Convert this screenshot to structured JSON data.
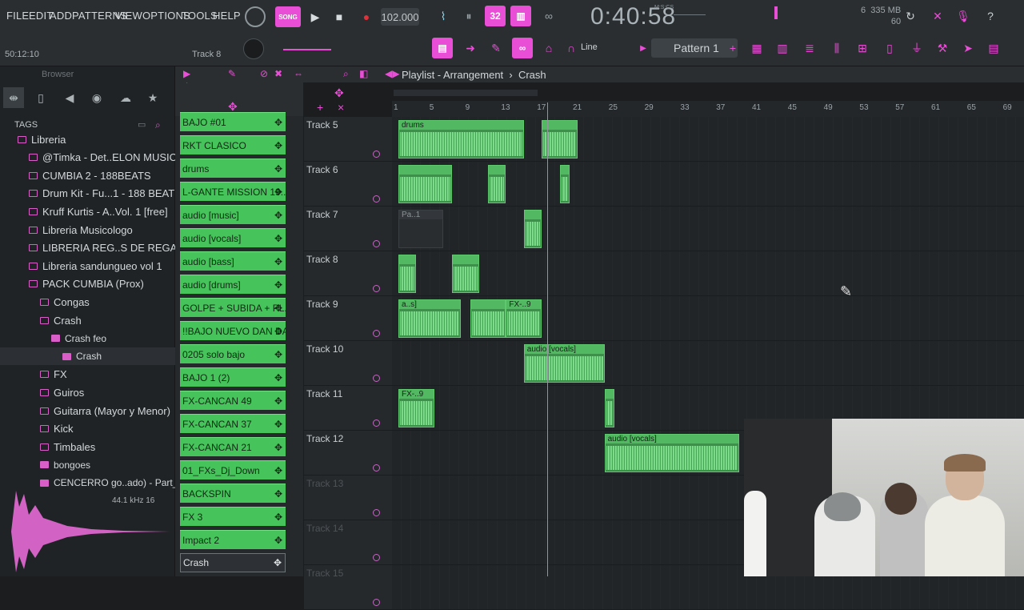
{
  "menu": [
    "FILE",
    "EDIT",
    "ADD",
    "PATTERNS",
    "VIEW",
    "OPTIONS",
    "TOOLS",
    "HELP"
  ],
  "transport": {
    "tempo": "102.000",
    "time": "0:40:58",
    "time_sub": "M:S:CS",
    "song_label": "SONG"
  },
  "status": {
    "mem": "335 MB",
    "cpu_count": "6",
    "poly": "60"
  },
  "hint": {
    "position": "50:12:10",
    "track": "Track 8"
  },
  "snap": {
    "value": "Line"
  },
  "pattern": {
    "name": "Pattern 1"
  },
  "browser": {
    "title": "Browser",
    "tags_label": "TAGS",
    "tree": [
      {
        "label": "Libreria",
        "indent": 1,
        "fill": false,
        "sel": false
      },
      {
        "label": "@Timka - Det..ELON MUSIC_",
        "indent": 2,
        "fill": false,
        "sel": false
      },
      {
        "label": "CUMBIA 2 - 188BEATS",
        "indent": 2,
        "fill": false,
        "sel": false
      },
      {
        "label": "Drum Kit - Fu...1 - 188 BEATS",
        "indent": 2,
        "fill": false,
        "sel": false
      },
      {
        "label": "Kruff Kurtis - A..Vol. 1 [free]",
        "indent": 2,
        "fill": false,
        "sel": false
      },
      {
        "label": "Libreria Musicologo",
        "indent": 2,
        "fill": false,
        "sel": false
      },
      {
        "label": "LIBRERIA REG..S DE REGALO",
        "indent": 2,
        "fill": false,
        "sel": false
      },
      {
        "label": "Libreria sandungueo vol 1",
        "indent": 2,
        "fill": false,
        "sel": false
      },
      {
        "label": "PACK CUMBIA (Prox)",
        "indent": 2,
        "fill": false,
        "sel": false
      },
      {
        "label": "Congas",
        "indent": 3,
        "fill": false,
        "sel": false
      },
      {
        "label": "Crash",
        "indent": 3,
        "fill": false,
        "sel": false
      },
      {
        "label": "Crash feo",
        "indent": 4,
        "fill": true,
        "sel": false
      },
      {
        "label": "Crash",
        "indent": 5,
        "fill": true,
        "sel": true
      },
      {
        "label": "FX",
        "indent": 3,
        "fill": false,
        "sel": false
      },
      {
        "label": "Guiros",
        "indent": 3,
        "fill": false,
        "sel": false
      },
      {
        "label": "Guitarra (Mayor y Menor)",
        "indent": 3,
        "fill": false,
        "sel": false
      },
      {
        "label": "Kick",
        "indent": 3,
        "fill": false,
        "sel": false
      },
      {
        "label": "Timbales",
        "indent": 3,
        "fill": false,
        "sel": false
      },
      {
        "label": "bongoes",
        "indent": 3,
        "fill": true,
        "sel": false
      },
      {
        "label": "CENCERRO go..ado) - Part_1",
        "indent": 3,
        "fill": true,
        "sel": false
      }
    ],
    "wave_info": "44.1 kHz 16"
  },
  "channels": [
    "BAJO #01",
    "RKT CLASICO",
    "drums",
    "L-GANTE MISSION 19..",
    "audio [music]",
    "audio [vocals]",
    "audio [bass]",
    "audio [drums]",
    "GOLPE + SUBIDA + PL..",
    "!!BAJO NUEVO DAN DA..",
    "0205 solo bajo",
    "BAJO 1 (2)",
    "FX-CANCAN 49",
    "FX-CANCAN 37",
    "FX-CANCAN 21",
    "01_FXs_Dj_Down",
    "BACKSPIN",
    "FX 3",
    "Impact 2",
    "Crash"
  ],
  "playlist": {
    "title": "Playlist - Arrangement",
    "crumb": "Crash",
    "ruler": [
      "1",
      "5",
      "9",
      "13",
      "17",
      "21",
      "25",
      "29",
      "33",
      "37",
      "41",
      "45",
      "49",
      "53",
      "57",
      "61",
      "65",
      "69"
    ],
    "tracks": [
      "Track 5",
      "Track 6",
      "Track 7",
      "Track 8",
      "Track 9",
      "Track 10",
      "Track 11",
      "Track 12",
      "Track 13",
      "Track 14",
      "Track 15"
    ],
    "clips": [
      {
        "track": 0,
        "bar": 1,
        "len": 14,
        "label": "drums"
      },
      {
        "track": 0,
        "bar": 17,
        "len": 4,
        "label": ""
      },
      {
        "track": 1,
        "bar": 1,
        "len": 6,
        "label": ""
      },
      {
        "track": 1,
        "bar": 11,
        "len": 2,
        "label": ""
      },
      {
        "track": 1,
        "bar": 19,
        "len": 1,
        "label": ""
      },
      {
        "track": 2,
        "bar": 1,
        "len": 5,
        "label": "Pa..1",
        "ghost": true
      },
      {
        "track": 2,
        "bar": 15,
        "len": 2,
        "label": ""
      },
      {
        "track": 3,
        "bar": 1,
        "len": 2,
        "label": ""
      },
      {
        "track": 3,
        "bar": 7,
        "len": 3,
        "label": ""
      },
      {
        "track": 4,
        "bar": 1,
        "len": 7,
        "label": "a..s]"
      },
      {
        "track": 4,
        "bar": 9,
        "len": 4,
        "label": ""
      },
      {
        "track": 4,
        "bar": 13,
        "len": 4,
        "label": "FX-..9"
      },
      {
        "track": 5,
        "bar": 15,
        "len": 9,
        "label": "audio [vocals]"
      },
      {
        "track": 6,
        "bar": 1,
        "len": 4,
        "label": "FX-..9"
      },
      {
        "track": 6,
        "bar": 24,
        "len": 1,
        "label": ""
      },
      {
        "track": 7,
        "bar": 24,
        "len": 15,
        "label": "audio [vocals]"
      }
    ]
  }
}
